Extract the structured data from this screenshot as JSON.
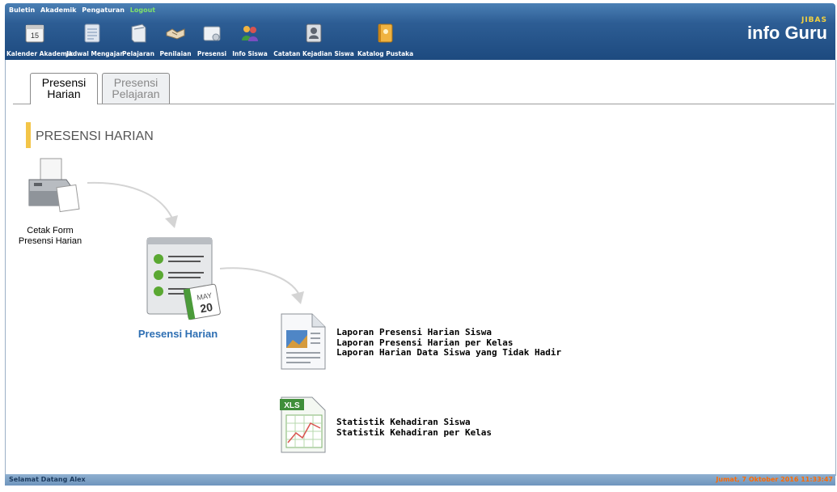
{
  "top_menu": {
    "buletin": "Buletin",
    "akademik": "Akademik",
    "pengaturan": "Pengaturan",
    "logout": "Logout"
  },
  "nav": [
    {
      "label": "Kalender Akademik",
      "icon": "calendar-icon",
      "day": "15"
    },
    {
      "label": "Jadwal Mengajar",
      "icon": "notepad-icon"
    },
    {
      "label": "Pelajaran",
      "icon": "book-icon"
    },
    {
      "label": "Penilaian",
      "icon": "handshake-icon"
    },
    {
      "label": "Presensi",
      "icon": "attendance-icon"
    },
    {
      "label": "Info Siswa",
      "icon": "students-icon"
    },
    {
      "label": "Catatan Kejadian Siswa",
      "icon": "contact-book-icon"
    },
    {
      "label": "Katalog Pustaka",
      "icon": "library-book-icon"
    }
  ],
  "brand": {
    "small": "JIBAS",
    "big": "info Guru"
  },
  "tabs": [
    {
      "line1": "Presensi",
      "line2": "Harian",
      "active": true
    },
    {
      "line1": "Presensi",
      "line2": "Pelajaran",
      "active": false
    }
  ],
  "section_title": "PRESENSI HARIAN",
  "print_form": {
    "line1": "Cetak Form",
    "line2": "Presensi Harian"
  },
  "main_link": "Presensi Harian",
  "calendar_badge": {
    "month": "MAY",
    "day": "20"
  },
  "reports": [
    "Laporan Presensi Harian Siswa",
    "Laporan Presensi Harian per Kelas",
    "Laporan Harian Data Siswa yang Tidak Hadir"
  ],
  "xls_badge": "XLS",
  "statistics": [
    "Statistik Kehadiran Siswa",
    "Statistik Kehadiran per Kelas"
  ],
  "status": {
    "welcome": "Selamat Datang Alex",
    "datetime": "Jumat, 7 Oktober 2016 11:33:47"
  },
  "colors": {
    "header": "#2d5d94",
    "link": "#2e6fb3",
    "section_bar": "#f3c548",
    "datetime": "#ff6a00"
  }
}
